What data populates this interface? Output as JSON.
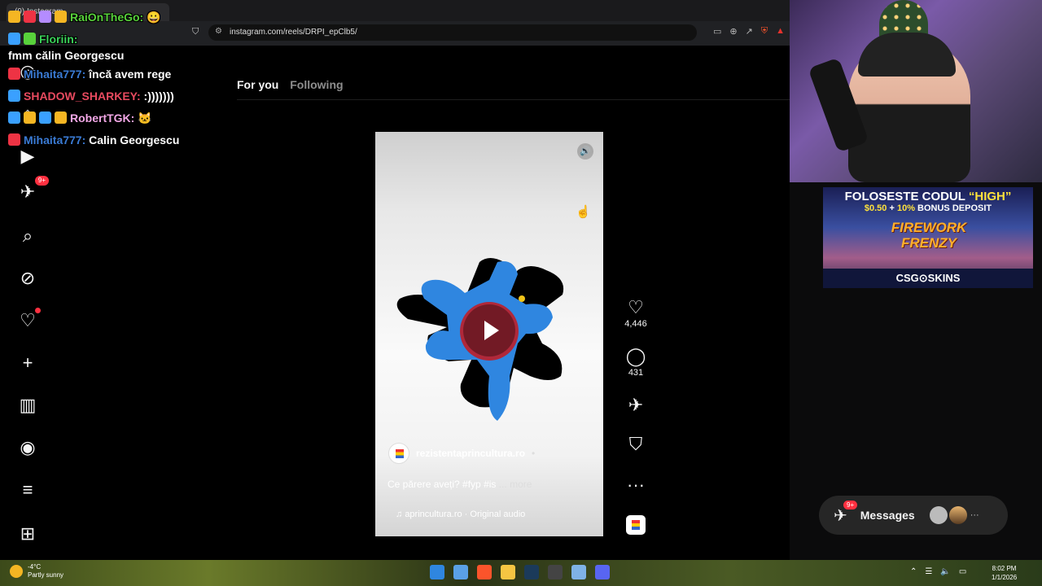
{
  "browser": {
    "tab_title": "(9) Instagram",
    "url": "instagram.com/reels/DRPI_epClb5/"
  },
  "instagram": {
    "feed_tabs": [
      "For you",
      "Following"
    ],
    "sidebar": {
      "notifications_badge": "9+"
    },
    "reel": {
      "author": "rezistentaprincultura.ro",
      "author_sep": "•",
      "caption_text": "Ce părere aveți? #fyp #is",
      "caption_more": "... more",
      "audio": "aprincultura.ro · Original audio"
    },
    "actions": {
      "likes": "4,446",
      "comments": "431"
    },
    "messages": {
      "label": "Messages",
      "badge": "9+",
      "more": "···"
    }
  },
  "chat": [
    {
      "user": "RaiOnTheGo:",
      "text": "",
      "color": "#58d23b"
    },
    {
      "user": "Floriin:",
      "text": "fmm călin Georgescu",
      "color": "#3bd25a"
    },
    {
      "user": "Mihaita777:",
      "text": "încă avem rege",
      "color": "#3a7bd5"
    },
    {
      "user": "SHADOW_SHARKEY:",
      "text": ":)))))))",
      "color": "#e84a5f"
    },
    {
      "user": "RobertTGK:",
      "text": "",
      "color": "#f2a7e6"
    },
    {
      "user": "Mihaita777:",
      "text": "Calin Georgescu",
      "color": "#3a7bd5"
    }
  ],
  "ad": {
    "line1_a": "FOLOSESTE CODUL ",
    "line1_b": "“HIGH”",
    "line2_a": "$0.50",
    "line2_b": " + ",
    "line2_c": "10%",
    "line2_d": " BONUS DEPOSIT",
    "title_1": "FIREWORK",
    "title_2": "FRENZY",
    "brand": "CSG⊙SKINS"
  },
  "taskbar": {
    "temp": "-4°C",
    "weather": "Partly sunny",
    "time": "8:02 PM",
    "date": "1/1/2026"
  },
  "colors": {
    "accent_red": "#ff3040",
    "splash_blue": "#2f86e0"
  }
}
